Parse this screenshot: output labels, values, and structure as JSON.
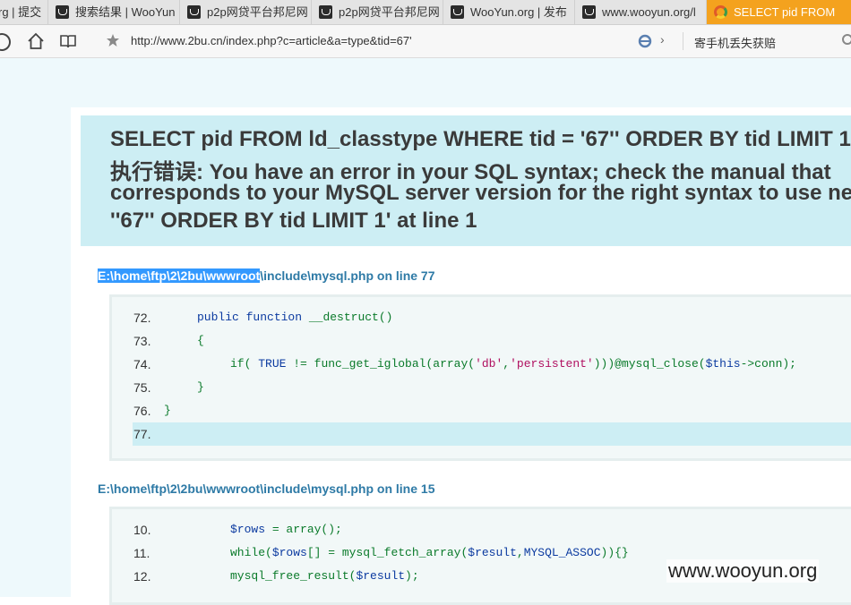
{
  "tabs": [
    {
      "title": "rg | 提交"
    },
    {
      "title": "搜索结果 | WooYun"
    },
    {
      "title": "p2p网贷平台邦尼网"
    },
    {
      "title": "p2p网贷平台邦尼网"
    },
    {
      "title": "WooYun.org | 发布"
    },
    {
      "title": "www.wooyun.org/l"
    },
    {
      "title": "SELECT pid FROM"
    }
  ],
  "toolbar": {
    "url": "http://www.2bu.cn/index.php?c=article&a=type&tid=67'",
    "search_text": "寄手机丢失获赔",
    "chevron": "›"
  },
  "error": {
    "lines": [
      "SELECT pid FROM ld_classtype WHERE tid = '67'' ORDER BY tid LIMIT 1",
      "执行错误: You have an error in your SQL syntax; check the manual that",
      "corresponds to your MySQL server version for the right syntax to use near",
      "''67'' ORDER BY tid LIMIT 1' at line 1"
    ]
  },
  "trace1": {
    "path_highlight": "E:\\home\\ftp\\2\\2bu\\wwwroot",
    "path_rest": "\\include\\mysql.php on line 77",
    "rows": [
      {
        "num": "72.",
        "code": "public function __destruct()"
      },
      {
        "num": "73.",
        "code": "{"
      },
      {
        "num": "74.",
        "code": "if( TRUE != func_get_iglobal(array('db','persistent')))@mysql_close($this->conn);"
      },
      {
        "num": "75.",
        "code": "}"
      },
      {
        "num": "76.",
        "code": "}"
      },
      {
        "num": "77.",
        "code": ""
      }
    ]
  },
  "trace2": {
    "path": "E:\\home\\ftp\\2\\2bu\\wwwroot\\include\\mysql.php on line 15",
    "rows": [
      {
        "num": "10.",
        "code": "$rows = array();"
      },
      {
        "num": "11.",
        "code": "while($rows[] = mysql_fetch_array($result,MYSQL_ASSOC)){}"
      },
      {
        "num": "12.",
        "code": "mysql_free_result($result);"
      }
    ]
  },
  "watermark": "www.wooyun.org",
  "colors": {
    "active_tab": "#f4a21e",
    "error_bg": "#cdeef4",
    "path_blue": "#2e7aa6",
    "code_green": "#0a7a2a",
    "selection": "#3399ff"
  }
}
